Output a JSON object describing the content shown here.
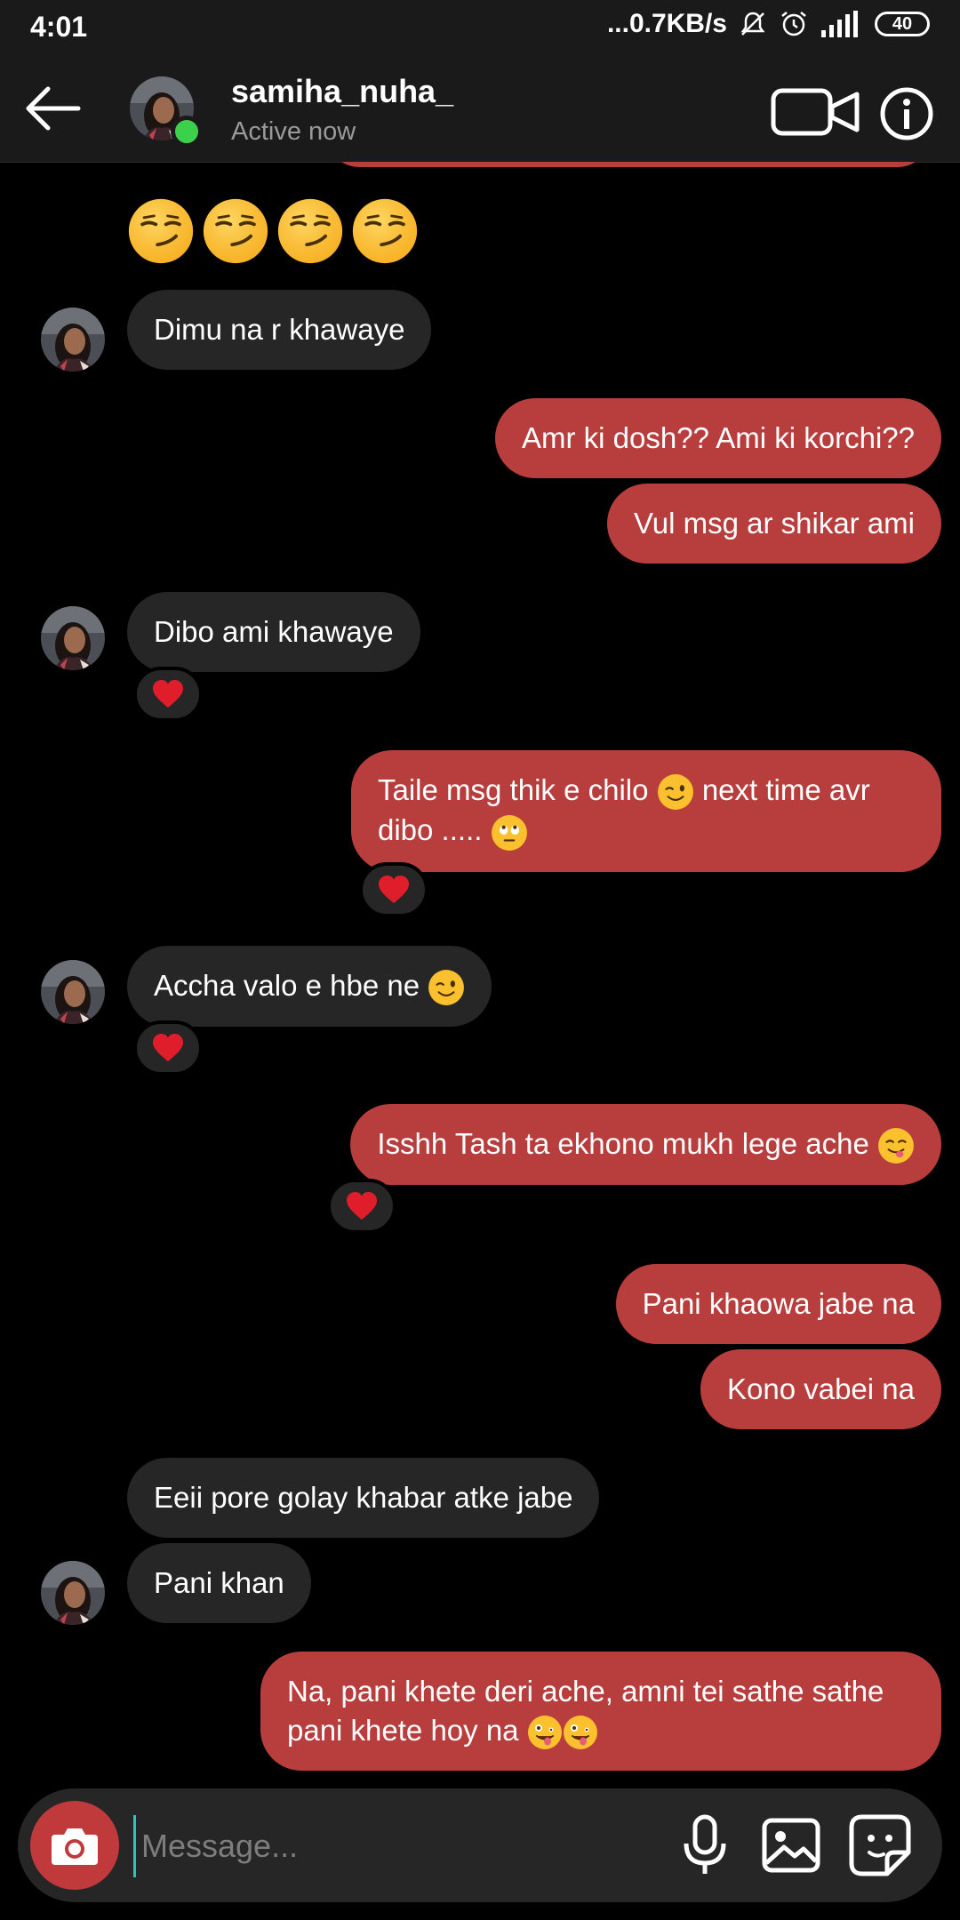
{
  "status_bar": {
    "time": "4:01",
    "network_speed": "...0.7KB/s",
    "battery": "40"
  },
  "header": {
    "username": "samiha_nuha_",
    "status": "Active now",
    "online_color": "#3bd14b"
  },
  "colors": {
    "outgoing_bubble": "#b83e3e",
    "incoming_bubble": "#262626",
    "background": "#000000"
  },
  "messages": [
    {
      "sender": "them",
      "text": "Dimu na r khawaye"
    },
    {
      "sender": "me",
      "text": "Amr ki dosh?? Ami ki korchi??"
    },
    {
      "sender": "me",
      "text": "Vul msg ar shikar ami"
    },
    {
      "sender": "them",
      "text": "Dibo ami khawaye",
      "reaction": "heart"
    },
    {
      "sender": "me",
      "text": "Taile msg thik e chilo",
      "text_2": "next time avr",
      "text_3": "dibo .....",
      "reaction": "heart"
    },
    {
      "sender": "them",
      "text": "Accha valo e hbe ne",
      "reaction": "heart"
    },
    {
      "sender": "me",
      "text": "Isshh Tash ta ekhono mukh lege ache",
      "reaction": "heart"
    },
    {
      "sender": "me",
      "text": "Pani khaowa jabe na"
    },
    {
      "sender": "me",
      "text": "Kono vabei na"
    },
    {
      "sender": "them",
      "text": "Eeii pore golay khabar atke jabe"
    },
    {
      "sender": "them",
      "text": "Pani khan"
    },
    {
      "sender": "me",
      "text": "Na, pani khete deri ache, amni tei sathe sathe",
      "text_2": "pani khete hoy na"
    }
  ],
  "composer": {
    "placeholder": "Message..."
  },
  "icons": {
    "back": "arrow-left-icon",
    "video": "video-camera-icon",
    "info": "info-icon",
    "camera": "camera-icon",
    "mic": "microphone-icon",
    "gallery": "image-icon",
    "sticker": "sticker-icon"
  }
}
